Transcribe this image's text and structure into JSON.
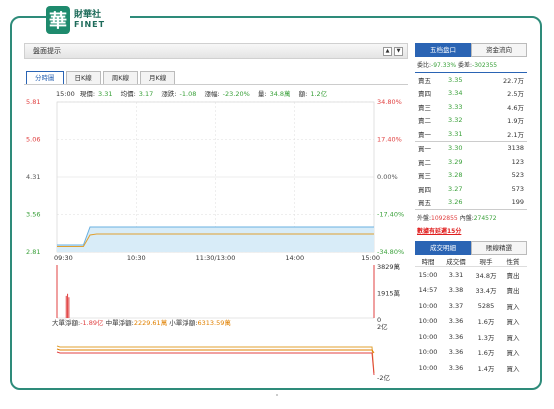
{
  "logo": {
    "mark": "華",
    "cn": "財華社",
    "en": "FINET"
  },
  "panel": {
    "title": "盤面提示",
    "up_btn": "▲",
    "down_btn": "▼"
  },
  "chart_tabs": [
    {
      "label": "分時圖",
      "active": true
    },
    {
      "label": "日K線",
      "active": false
    },
    {
      "label": "周K線",
      "active": false
    },
    {
      "label": "月K線",
      "active": false
    }
  ],
  "info": {
    "time": "15:00",
    "price_label": "現價:",
    "price": "3.31",
    "avg_label": "均價:",
    "avg": "3.17",
    "chg_label": "漲跌:",
    "chg": "-1.08",
    "pct_label": "漲幅:",
    "pct": "-23.20%",
    "vol_label": "量:",
    "vol": "34.8萬",
    "amt_label": "額:",
    "amt": "1.2亿"
  },
  "chart_data": {
    "type": "line",
    "y_ticks_left": [
      "5.81",
      "5.06",
      "4.31",
      "3.56",
      "2.81"
    ],
    "y_ticks_right": [
      "34.80%",
      "17.40%",
      "0.00%",
      "-17.40%",
      "-34.80%"
    ],
    "x_ticks": [
      "09:30",
      "10:30",
      "11:30/13:00",
      "14:00",
      "15:00"
    ],
    "ylim": [
      2.81,
      5.81
    ],
    "series": [
      {
        "name": "現價",
        "x": [
          "09:30",
          "09:50",
          "09:55",
          "10:00",
          "11:30",
          "13:00",
          "14:00",
          "14:55",
          "15:00"
        ],
        "values": [
          2.95,
          2.95,
          3.31,
          3.31,
          3.31,
          3.31,
          3.31,
          3.31,
          3.31
        ]
      },
      {
        "name": "均價",
        "x": [
          "09:30",
          "09:50",
          "09:55",
          "10:00",
          "11:30",
          "13:00",
          "14:00",
          "14:55",
          "15:00"
        ],
        "values": [
          2.92,
          2.92,
          3.15,
          3.17,
          3.17,
          3.17,
          3.17,
          3.17,
          3.17
        ]
      }
    ],
    "volume_ticks": [
      "3829萬",
      "1915萬",
      "0"
    ],
    "volume_bars_x": [
      "09:30",
      "09:37",
      "09:38",
      "09:39",
      "15:00"
    ],
    "volume_bars_values": [
      3829,
      1600,
      1750,
      1500,
      3829
    ],
    "flow_ticks": [
      "2亿",
      "-2亿"
    ]
  },
  "flow_text": {
    "big_label": "大單淨額:",
    "big": "-1.89亿",
    "mid_label": "中單淨額:",
    "mid": "2229.61萬",
    "small_label": "小單淨額:",
    "small": "6313.59萬"
  },
  "right_tabs": [
    {
      "label": "五档盘口",
      "active": true
    },
    {
      "label": "资金流向",
      "active": false
    }
  ],
  "ratio": {
    "wb_label": "委比:",
    "wb": "-97.33%",
    "wc_label": "委差:",
    "wc": "-302355"
  },
  "sells": [
    {
      "label": "賣五",
      "price": "3.35",
      "vol": "22.7万"
    },
    {
      "label": "賣四",
      "price": "3.34",
      "vol": "2.5万"
    },
    {
      "label": "賣三",
      "price": "3.33",
      "vol": "4.6万"
    },
    {
      "label": "賣二",
      "price": "3.32",
      "vol": "1.9万"
    },
    {
      "label": "賣一",
      "price": "3.31",
      "vol": "2.1万"
    }
  ],
  "buys": [
    {
      "label": "買一",
      "price": "3.30",
      "vol": "3138"
    },
    {
      "label": "買二",
      "price": "3.29",
      "vol": "123"
    },
    {
      "label": "買三",
      "price": "3.28",
      "vol": "523"
    },
    {
      "label": "買四",
      "price": "3.27",
      "vol": "573"
    },
    {
      "label": "買五",
      "price": "3.26",
      "vol": "199"
    }
  ],
  "totals": {
    "out_label": "外盤:",
    "out": "1092855",
    "in_label": "內盤:",
    "in": "274572"
  },
  "warn_link": "數據有延遲15分",
  "trade_tabs": [
    {
      "label": "成交明細",
      "active": true
    },
    {
      "label": "賬線精選",
      "active": false
    }
  ],
  "trade_head": {
    "time": "時間",
    "price": "成交價",
    "vol": "現手",
    "side": "性質"
  },
  "trades": [
    {
      "time": "15:00",
      "price": "3.31",
      "vol": "34.8万",
      "side": "賣出"
    },
    {
      "time": "14:57",
      "price": "3.38",
      "vol": "33.4万",
      "side": "賣出"
    },
    {
      "time": "10:00",
      "price": "3.37",
      "vol": "5285",
      "side": "買入"
    },
    {
      "time": "10:00",
      "price": "3.36",
      "vol": "1.6万",
      "side": "買入"
    },
    {
      "time": "10:00",
      "price": "3.36",
      "vol": "1.3万",
      "side": "買入"
    },
    {
      "time": "10:00",
      "price": "3.36",
      "vol": "1.6万",
      "side": "買入"
    },
    {
      "time": "10:00",
      "price": "3.36",
      "vol": "1.4万",
      "side": "買入"
    }
  ],
  "colors": {
    "frame": "#2e8b7a",
    "accent": "#2a64b4",
    "up": "#e04040",
    "down": "#39a039"
  }
}
